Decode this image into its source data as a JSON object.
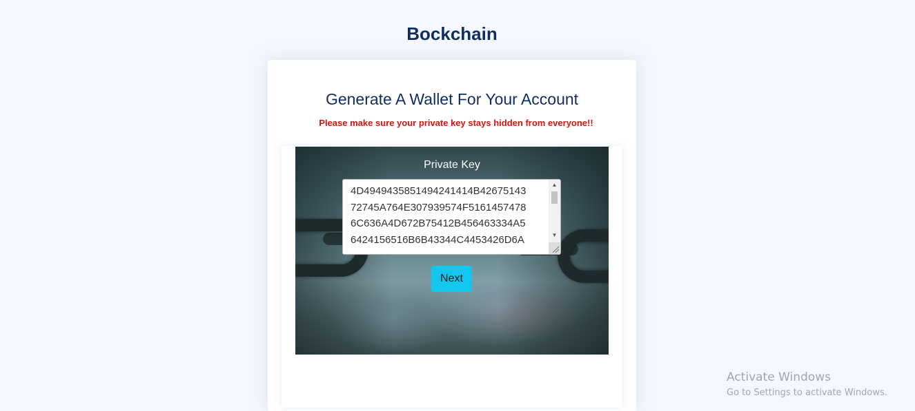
{
  "header": {
    "app_title": "Bockchain"
  },
  "wallet_card": {
    "heading": "Generate A Wallet For Your Account",
    "warning": "Please make sure your private key stays hidden from everyone!!",
    "key_label": "Private Key",
    "private_key_value": "4D494943585149424141 4B42675143 72745A764E307939574F5161457478 6C636A4D672B75412B456463334A5 6424156516B6B43344C4453426D6A ",
    "private_key_lines": [
      "4D4949435851494241414B42675143",
      "72745A764E307939574F5161457478",
      "6C636A4D672B75412B456463334A5",
      "6424156516B6B43344C4453426D6A"
    ],
    "next_label": "Next"
  },
  "os_watermark": {
    "title": "Activate Windows",
    "subtitle": "Go to Settings to activate Windows."
  },
  "colors": {
    "page_bg": "#f4f7fd",
    "title": "#0f2d5e",
    "warning": "#d4150d",
    "accent_button": "#13c6ee"
  },
  "icons": {
    "scroll_up": "triangle-up-icon",
    "scroll_down": "triangle-down-icon",
    "resize": "resize-grip-icon"
  }
}
